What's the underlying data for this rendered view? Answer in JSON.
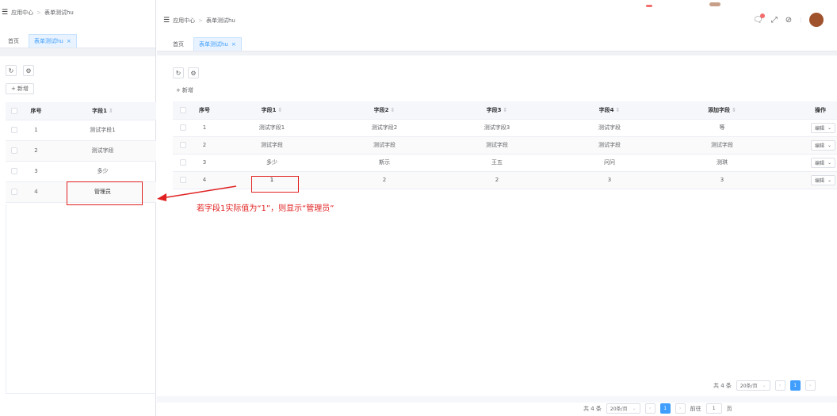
{
  "left": {
    "breadcrumb": {
      "root": "应用中心",
      "sep": ">",
      "current": "表单测试hu"
    },
    "tabs": [
      {
        "label": "首页"
      },
      {
        "label": "表单测试hu",
        "close": "×"
      }
    ],
    "add_label": "新增",
    "columns": [
      "序号",
      "字段1"
    ],
    "rows": [
      {
        "idx": "1",
        "f1": "测试字段1"
      },
      {
        "idx": "2",
        "f1": "测试字段"
      },
      {
        "idx": "3",
        "f1": "多少"
      },
      {
        "idx": "4",
        "f1": "管理员"
      }
    ]
  },
  "main": {
    "breadcrumb": {
      "root": "应用中心",
      "sep": ">",
      "current": "表单测试hu"
    },
    "tabs": [
      {
        "label": "首页"
      },
      {
        "label": "表单测试hu",
        "close": "×"
      }
    ],
    "add_label": "新增",
    "columns": [
      "序号",
      "字段1",
      "字段2",
      "字段3",
      "字段4",
      "添加字段",
      "操作"
    ],
    "rows": [
      {
        "idx": "1",
        "c": [
          "测试字段1",
          "测试字段2",
          "测试字段3",
          "测试字段",
          "等"
        ],
        "op": "编辑"
      },
      {
        "idx": "2",
        "c": [
          "测试字段",
          "测试字段",
          "测试字段",
          "测试字段",
          "测试字段"
        ],
        "op": "编辑"
      },
      {
        "idx": "3",
        "c": [
          "多少",
          "斯示",
          "王五",
          "问问",
          "测琪"
        ],
        "op": "编辑"
      },
      {
        "idx": "4",
        "c": [
          "1",
          "2",
          "2",
          "3",
          "3"
        ],
        "op": "编辑"
      }
    ],
    "pager": {
      "total": "共 4 条",
      "size": "20条/页",
      "current": "1"
    }
  },
  "annotation": "若字段1实际值为“1”，则显示“管理员”",
  "bottom_pager": {
    "total": "共 4 条",
    "size": "20条/页",
    "current": "1",
    "goto": "前往",
    "goto_value": "1",
    "page_unit": "页"
  },
  "colors": {
    "accent": "#409eff",
    "annotation_red": "#e02020"
  }
}
